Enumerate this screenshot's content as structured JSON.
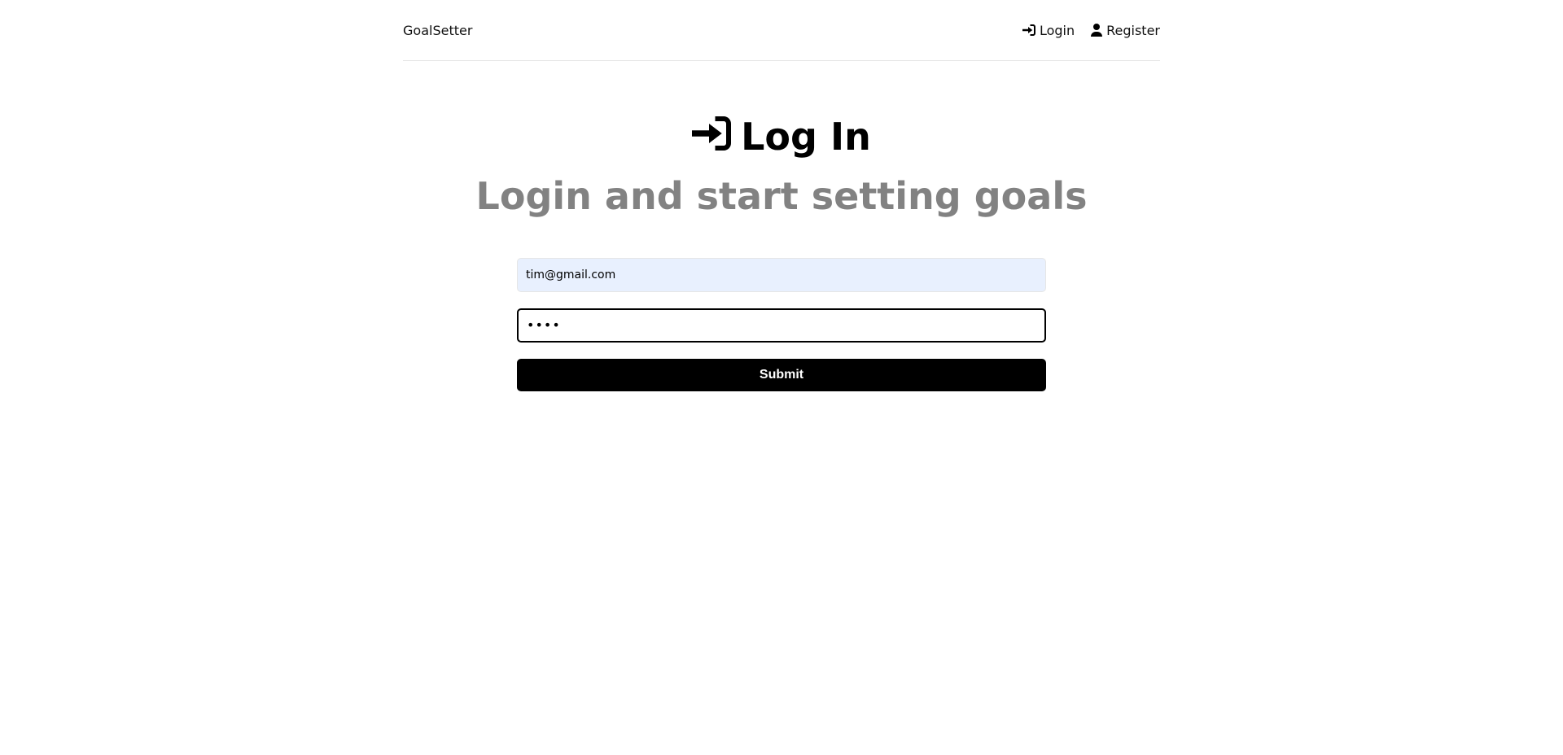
{
  "header": {
    "brand": "GoalSetter",
    "nav": {
      "login_label": "Login",
      "login_icon": "sign-in-icon",
      "register_label": "Register",
      "register_icon": "user-icon"
    }
  },
  "main": {
    "title": "Log In",
    "title_icon": "sign-in-icon",
    "subtitle": "Login and start setting goals"
  },
  "form": {
    "email_value": "tim@gmail.com",
    "password_value": "••••",
    "submit_label": "Submit"
  },
  "colors": {
    "subtitle": "#828282",
    "autofill_bg": "#e8f0fe",
    "button_bg": "#000000"
  }
}
